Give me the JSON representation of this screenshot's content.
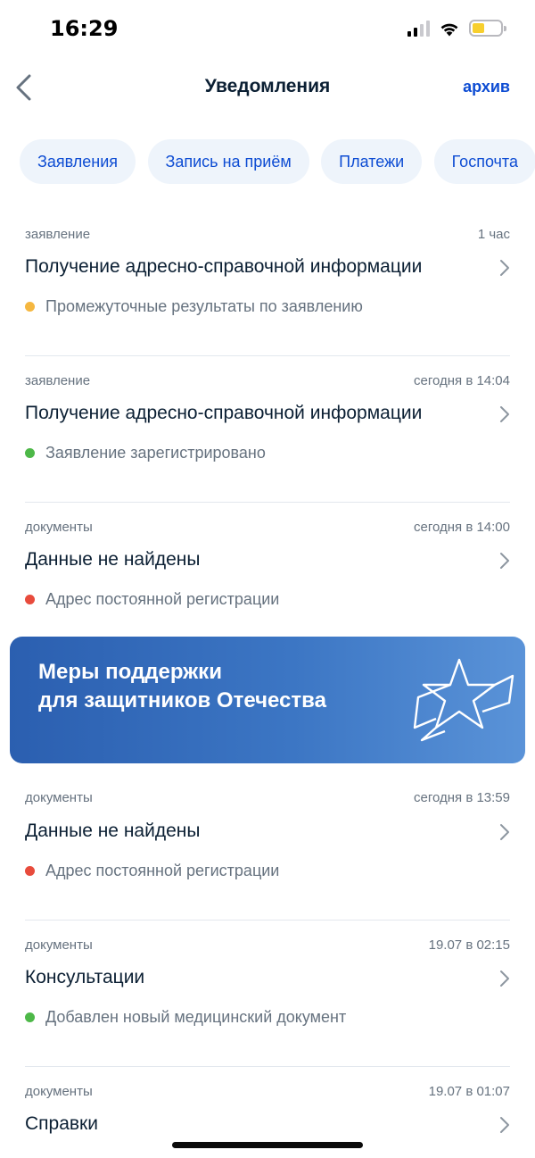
{
  "status_bar": {
    "time": "16:29"
  },
  "header": {
    "title": "Уведомления",
    "archive_label": "архив"
  },
  "chips": [
    {
      "label": "Заявления"
    },
    {
      "label": "Запись на приём"
    },
    {
      "label": "Платежи"
    },
    {
      "label": "Госпочта"
    }
  ],
  "notifications": [
    {
      "category": "заявление",
      "time": "1 час",
      "title": "Получение адресно-справочной информации",
      "status": "Промежуточные результаты по заявлению",
      "status_color": "#f5b740"
    },
    {
      "category": "заявление",
      "time": "сегодня в 14:04",
      "title": "Получение адресно-справочной информации",
      "status": "Заявление зарегистрировано",
      "status_color": "#4db848"
    },
    {
      "category": "документы",
      "time": "сегодня в 14:00",
      "title": "Данные не найдены",
      "status": "Адрес постоянной регистрации",
      "status_color": "#e84b3c"
    }
  ],
  "banner": {
    "line1": "Меры поддержки",
    "line2": "для защитников Отечества",
    "icon": "star-icon"
  },
  "notifications_after_banner": [
    {
      "category": "документы",
      "time": "сегодня в 13:59",
      "title": "Данные не найдены",
      "status": "Адрес постоянной регистрации",
      "status_color": "#e84b3c"
    },
    {
      "category": "документы",
      "time": "19.07 в 02:15",
      "title": "Консультации",
      "status": "Добавлен новый медицинский документ",
      "status_color": "#4db848"
    },
    {
      "category": "документы",
      "time": "19.07 в 01:07",
      "title": "Справки"
    }
  ],
  "colors": {
    "accent": "#0d4cd3",
    "chip_bg": "#eef4fb",
    "banner_start": "#2b5fb0",
    "banner_end": "#5a93d8"
  }
}
